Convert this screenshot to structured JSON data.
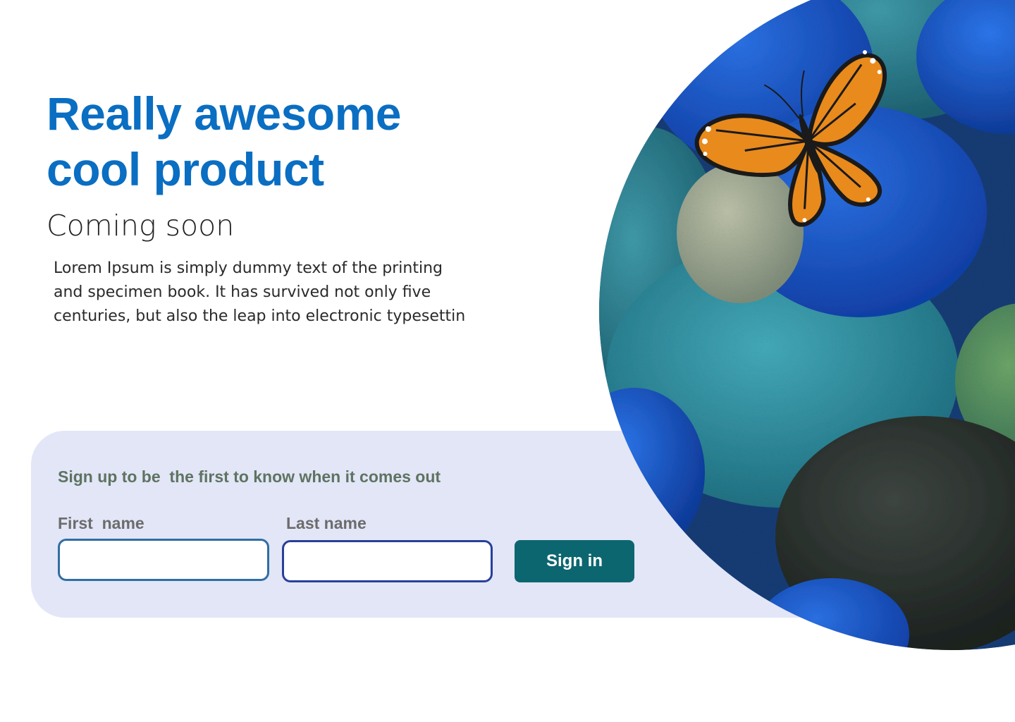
{
  "hero": {
    "title": "Really awesome cool product",
    "subtitle": "Coming soon",
    "description": "Lorem Ipsum is simply dummy text of the printing and specimen book. It has survived not only five centuries, but also the leap into electronic typesettin",
    "image_icon": "butterfly-on-stones-photo"
  },
  "signup": {
    "title": "Sign up to be  the first to know when it comes out",
    "first_name_label": "First  name",
    "first_name_value": "",
    "first_name_placeholder": "",
    "last_name_label": "Last name",
    "last_name_value": "",
    "last_name_placeholder": "",
    "submit_label": "Sign in"
  },
  "colors": {
    "title": "#0a6ec2",
    "card_background": "#e2e6f7",
    "signup_title": "#5e7361",
    "label": "#6c6c6c",
    "button": "#0c6670",
    "button_text": "#ffffff"
  }
}
